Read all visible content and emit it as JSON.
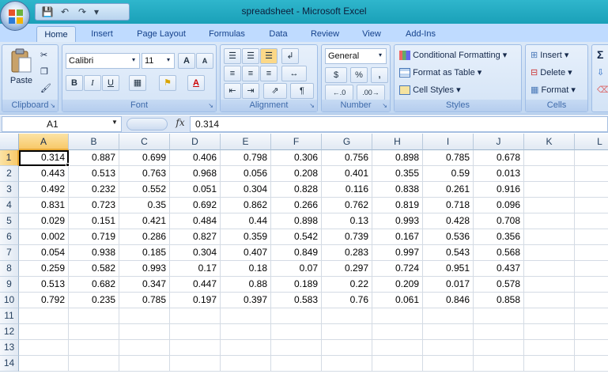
{
  "window": {
    "title": "spreadsheet - Microsoft Excel"
  },
  "tabs": [
    {
      "label": "Home",
      "active": true
    },
    {
      "label": "Insert"
    },
    {
      "label": "Page Layout"
    },
    {
      "label": "Formulas"
    },
    {
      "label": "Data"
    },
    {
      "label": "Review"
    },
    {
      "label": "View"
    },
    {
      "label": "Add-Ins"
    }
  ],
  "ribbon": {
    "clipboard": {
      "label": "Clipboard",
      "paste": "Paste"
    },
    "font": {
      "label": "Font",
      "font_name": "Calibri",
      "font_size": "11",
      "grow": "A",
      "shrink": "A",
      "bold": "B",
      "italic": "I",
      "underline": "U"
    },
    "alignment": {
      "label": "Alignment"
    },
    "number": {
      "label": "Number",
      "format": "General",
      "currency": "$",
      "percent": "%",
      "comma": ","
    },
    "styles": {
      "label": "Styles",
      "conditional": "Conditional Formatting",
      "format_table": "Format as Table",
      "cell_styles": "Cell Styles"
    },
    "cells": {
      "label": "Cells",
      "insert": "Insert",
      "delete": "Delete",
      "format": "Format"
    },
    "editing": {
      "sigma": "Σ"
    }
  },
  "formula_bar": {
    "name_box": "A1",
    "fx": "fx",
    "value": "0.314"
  },
  "grid": {
    "columns": [
      "A",
      "B",
      "C",
      "D",
      "E",
      "F",
      "G",
      "H",
      "I",
      "J",
      "K",
      "L"
    ],
    "rows": [
      "1",
      "2",
      "3",
      "4",
      "5",
      "6",
      "7",
      "8",
      "9",
      "10",
      "11",
      "12",
      "13",
      "14"
    ],
    "active_cell": "A1",
    "values": [
      [
        "0.314",
        "0.887",
        "0.699",
        "0.406",
        "0.798",
        "0.306",
        "0.756",
        "0.898",
        "0.785",
        "0.678"
      ],
      [
        "0.443",
        "0.513",
        "0.763",
        "0.968",
        "0.056",
        "0.208",
        "0.401",
        "0.355",
        "0.59",
        "0.013"
      ],
      [
        "0.492",
        "0.232",
        "0.552",
        "0.051",
        "0.304",
        "0.828",
        "0.116",
        "0.838",
        "0.261",
        "0.916"
      ],
      [
        "0.831",
        "0.723",
        "0.35",
        "0.692",
        "0.862",
        "0.266",
        "0.762",
        "0.819",
        "0.718",
        "0.096"
      ],
      [
        "0.029",
        "0.151",
        "0.421",
        "0.484",
        "0.44",
        "0.898",
        "0.13",
        "0.993",
        "0.428",
        "0.708"
      ],
      [
        "0.002",
        "0.719",
        "0.286",
        "0.827",
        "0.359",
        "0.542",
        "0.739",
        "0.167",
        "0.536",
        "0.356"
      ],
      [
        "0.054",
        "0.938",
        "0.185",
        "0.304",
        "0.407",
        "0.849",
        "0.283",
        "0.997",
        "0.543",
        "0.568"
      ],
      [
        "0.259",
        "0.582",
        "0.993",
        "0.17",
        "0.18",
        "0.07",
        "0.297",
        "0.724",
        "0.951",
        "0.437"
      ],
      [
        "0.513",
        "0.682",
        "0.347",
        "0.447",
        "0.88",
        "0.189",
        "0.22",
        "0.209",
        "0.017",
        "0.578"
      ],
      [
        "0.792",
        "0.235",
        "0.785",
        "0.197",
        "0.397",
        "0.583",
        "0.76",
        "0.061",
        "0.846",
        "0.858"
      ]
    ]
  }
}
